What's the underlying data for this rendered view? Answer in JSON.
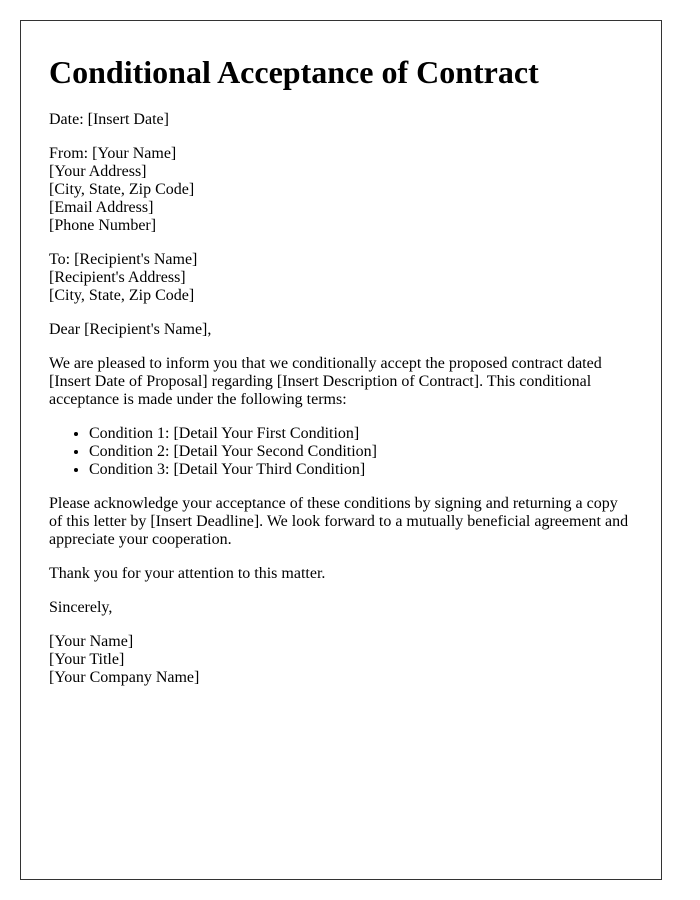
{
  "document": {
    "title": "Conditional Acceptance of Contract",
    "date_line": "Date: [Insert Date]",
    "from_block": [
      "From: [Your Name]",
      "[Your Address]",
      "[City, State, Zip Code]",
      "[Email Address]",
      "[Phone Number]"
    ],
    "to_block": [
      "To: [Recipient's Name]",
      "[Recipient's Address]",
      "[City, State, Zip Code]"
    ],
    "salutation": "Dear [Recipient's Name],",
    "intro_paragraph": "We are pleased to inform you that we conditionally accept the proposed contract dated [Insert Date of Proposal] regarding [Insert Description of Contract]. This conditional acceptance is made under the following terms:",
    "conditions": [
      "Condition 1: [Detail Your First Condition]",
      "Condition 2: [Detail Your Second Condition]",
      "Condition 3: [Detail Your Third Condition]"
    ],
    "acknowledge_paragraph": "Please acknowledge your acceptance of these conditions by signing and returning a copy of this letter by [Insert Deadline]. We look forward to a mutually beneficial agreement and appreciate your cooperation.",
    "thanks_paragraph": "Thank you for your attention to this matter.",
    "closing": "Sincerely,",
    "signature_block": [
      "[Your Name]",
      "[Your Title]",
      "[Your Company Name]"
    ]
  }
}
